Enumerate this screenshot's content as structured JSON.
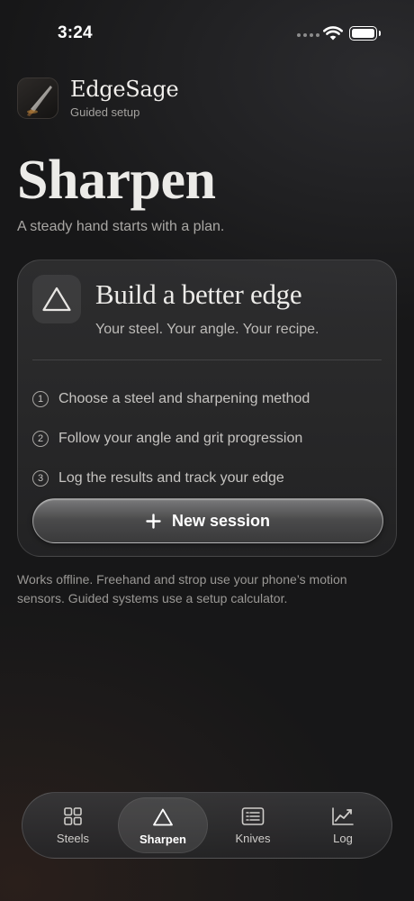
{
  "status": {
    "time": "3:24"
  },
  "app": {
    "name": "EdgeSage",
    "subtitle": "Guided setup",
    "logo_icon": "knife-blade-icon"
  },
  "page": {
    "title": "Sharpen",
    "subtitle": "A steady hand starts with a plan."
  },
  "card": {
    "icon": "triangle-icon",
    "title": "Build a better edge",
    "subtitle": "Your steel. Your angle. Your recipe.",
    "steps": [
      {
        "num": "1",
        "text": "Choose a steel and sharpening method"
      },
      {
        "num": "2",
        "text": "Follow your angle and grit progression"
      },
      {
        "num": "3",
        "text": "Log the results and track your edge"
      }
    ],
    "cta_label": "New session"
  },
  "footnote": "Works offline. Freehand and strop use your phone’s motion sensors. Guided systems use a setup calculator.",
  "tabbar": {
    "tabs": [
      {
        "label": "Steels",
        "icon": "grid-icon"
      },
      {
        "label": "Sharpen",
        "icon": "triangle-icon",
        "active": true
      },
      {
        "label": "Knives",
        "icon": "list-icon"
      },
      {
        "label": "Log",
        "icon": "chart-line-icon"
      }
    ]
  }
}
